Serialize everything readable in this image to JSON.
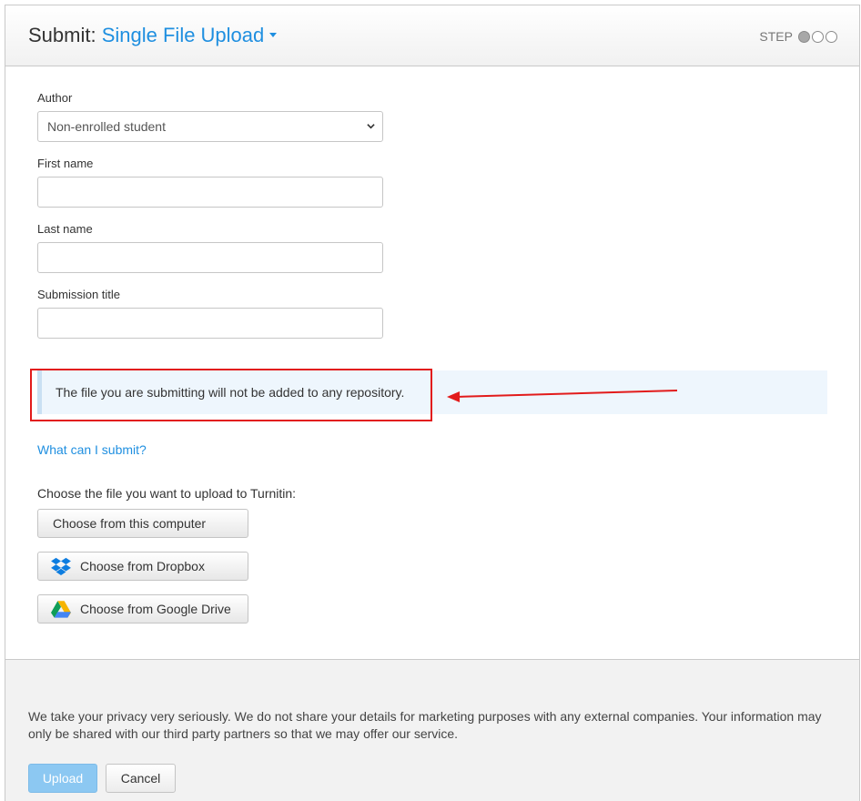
{
  "header": {
    "title_prefix": "Submit:",
    "title_link": "Single File Upload",
    "step_label": "STEP",
    "step_current": 1,
    "step_total": 3
  },
  "form": {
    "author_label": "Author",
    "author_value": "Non-enrolled student",
    "first_name_label": "First name",
    "first_name_value": "",
    "last_name_label": "Last name",
    "last_name_value": "",
    "submission_title_label": "Submission title",
    "submission_title_value": ""
  },
  "notice": {
    "text": "The file you are submitting will not be added to any repository."
  },
  "help_link": "What can I submit?",
  "upload": {
    "instruction": "Choose the file you want to upload to Turnitin:",
    "from_computer": "Choose from this computer",
    "from_dropbox": "Choose from Dropbox",
    "from_google_drive": "Choose from Google Drive"
  },
  "footer": {
    "privacy_text": "We take your privacy very seriously. We do not share your details for marketing purposes with any external companies. Your information may only be shared with our third party partners so that we may offer our service.",
    "upload_button": "Upload",
    "cancel_button": "Cancel"
  },
  "colors": {
    "link": "#1f8fe0",
    "annotation": "#e21b1b",
    "upload_button_bg": "#8cc8f2",
    "notice_bg": "#eef6fd"
  }
}
